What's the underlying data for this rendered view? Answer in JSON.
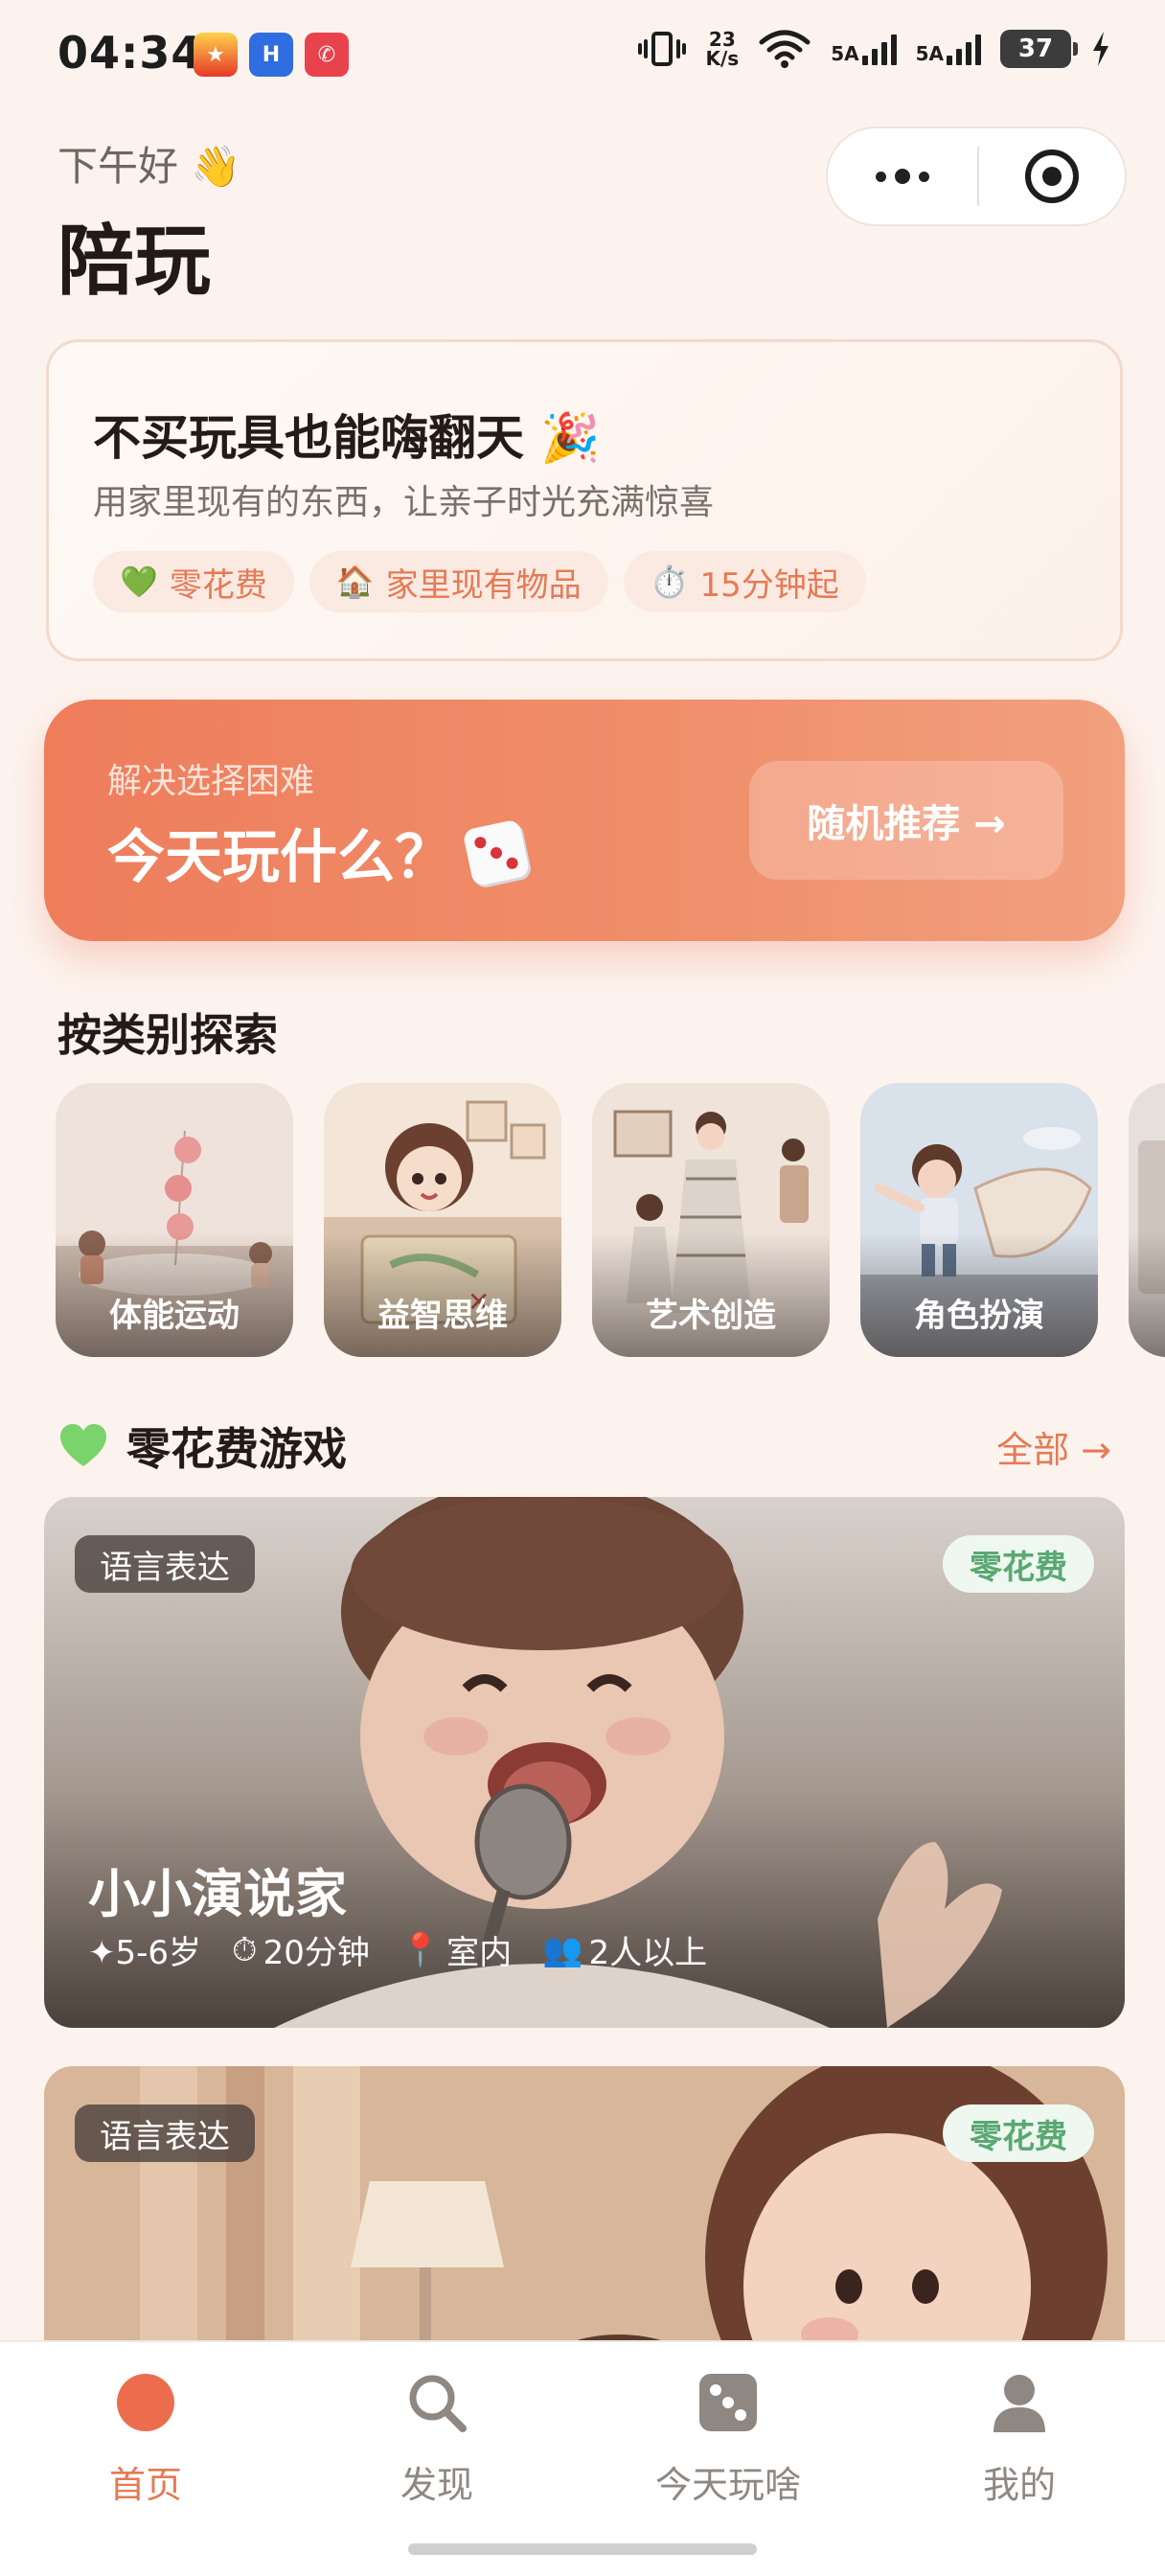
{
  "status_bar": {
    "time": "04:34",
    "net_speed_value": "23",
    "net_speed_unit": "K/s",
    "sim1_label": "5A",
    "sim2_label": "5A",
    "battery": "37",
    "icons": [
      "vibrate-icon",
      "wifi-icon",
      "signal-icon",
      "charging-icon"
    ]
  },
  "header": {
    "greeting": "下午好 👋",
    "title": "陪玩"
  },
  "promo": {
    "title": "不买玩具也能嗨翻天 🎉",
    "subtitle": "用家里现有的东西，让亲子时光充满惊喜",
    "tags": [
      {
        "icon": "💚",
        "label": "零花费"
      },
      {
        "icon": "🏠",
        "label": "家里现有物品"
      },
      {
        "icon": "⏱️",
        "label": "15分钟起"
      }
    ]
  },
  "random_banner": {
    "subtitle": "解决选择困难",
    "title": "今天玩什么？",
    "button_label": "随机推荐 →"
  },
  "categories": {
    "title": "按类别探索",
    "items": [
      {
        "label": "体能运动"
      },
      {
        "label": "益智思维"
      },
      {
        "label": "艺术创造"
      },
      {
        "label": "角色扮演"
      }
    ]
  },
  "free_games": {
    "title": "零花费游戏",
    "see_all": "全部 →",
    "cards": [
      {
        "category": "语言表达",
        "badge": "零花费",
        "title": "小小演说家",
        "age": "✦5-6岁",
        "duration": "20分钟",
        "location": "室内",
        "players": "2人以上"
      },
      {
        "category": "语言表达",
        "badge": "零花费"
      }
    ]
  },
  "tab_bar": {
    "items": [
      {
        "label": "首页",
        "icon": "home-icon",
        "active": true
      },
      {
        "label": "发现",
        "icon": "search-icon",
        "active": false
      },
      {
        "label": "今天玩啥",
        "icon": "dice-icon",
        "active": false
      },
      {
        "label": "我的",
        "icon": "user-icon",
        "active": false
      }
    ]
  },
  "colors": {
    "accent": "#e57a55",
    "banner": "#ee7d5c",
    "free_green": "#5aa872",
    "background": "#fdf3ee"
  }
}
